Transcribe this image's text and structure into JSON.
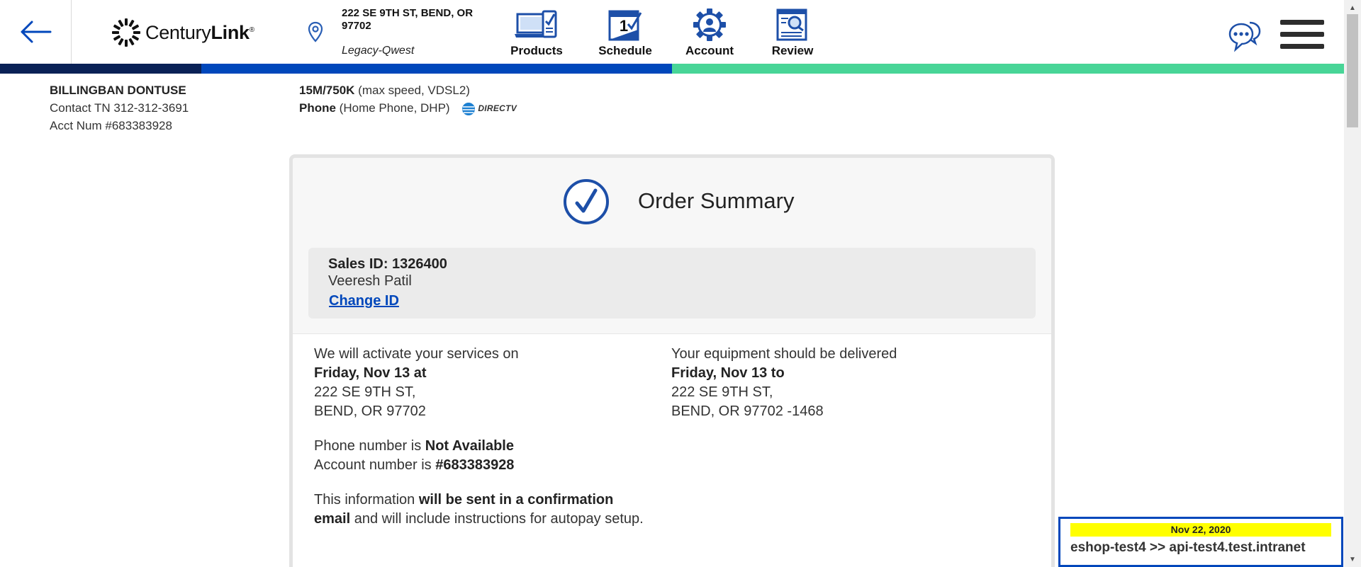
{
  "header": {
    "logo_brand_regular": "Century",
    "logo_brand_bold": "Link",
    "logo_mark": "®",
    "address_line": "222 SE 9TH ST, BEND, OR 97702",
    "address_sub": "Legacy-Qwest",
    "nav": [
      {
        "label": "Products",
        "icon": "laptop-checklist-icon"
      },
      {
        "label": "Schedule",
        "icon": "calendar-check-icon"
      },
      {
        "label": "Account",
        "icon": "user-gear-icon"
      },
      {
        "label": "Review",
        "icon": "document-search-icon"
      }
    ]
  },
  "customer": {
    "name": "BILLINGBAN DONTUSE",
    "contact": "Contact TN 312-312-3691",
    "account": "Acct Num #683383928"
  },
  "services": {
    "internet_speed": "15M/750K",
    "internet_detail": " (max speed, VDSL2)",
    "phone_label": "Phone",
    "phone_detail": " (Home Phone, DHP)",
    "partner_logo": "DIRECTV"
  },
  "order": {
    "title": "Order Summary",
    "sales_id": "Sales ID: 1326400",
    "agent_name": "Veeresh Patil",
    "change_id_label": "Change ID",
    "activation": {
      "intro": "We will activate your services on",
      "date": "Friday, Nov 13 at",
      "street": "222 SE 9TH ST,",
      "city": "BEND, OR 97702"
    },
    "phone_prefix": "Phone number is ",
    "phone_value": "Not Available",
    "account_prefix": "Account number is ",
    "account_value": "#683383928",
    "info_prefix": "This information ",
    "info_bold": "will be sent in a confirmation email",
    "info_suffix": " and will include instructions for autopay setup.",
    "delivery": {
      "intro": "Your equipment should be delivered",
      "date": "Friday, Nov 13 to",
      "street": "222 SE 9TH ST,",
      "city": "BEND, OR 97702 -1468"
    }
  },
  "environment": {
    "date": "Nov 22, 2020",
    "host": "eshop-test4 >> api-test4.test.intranet"
  },
  "colors": {
    "progress_dark": "#0a2156",
    "progress_blue": "#0047bb",
    "progress_green": "#48d597",
    "accent": "#0047bb",
    "badge_highlight": "#ffff00"
  }
}
